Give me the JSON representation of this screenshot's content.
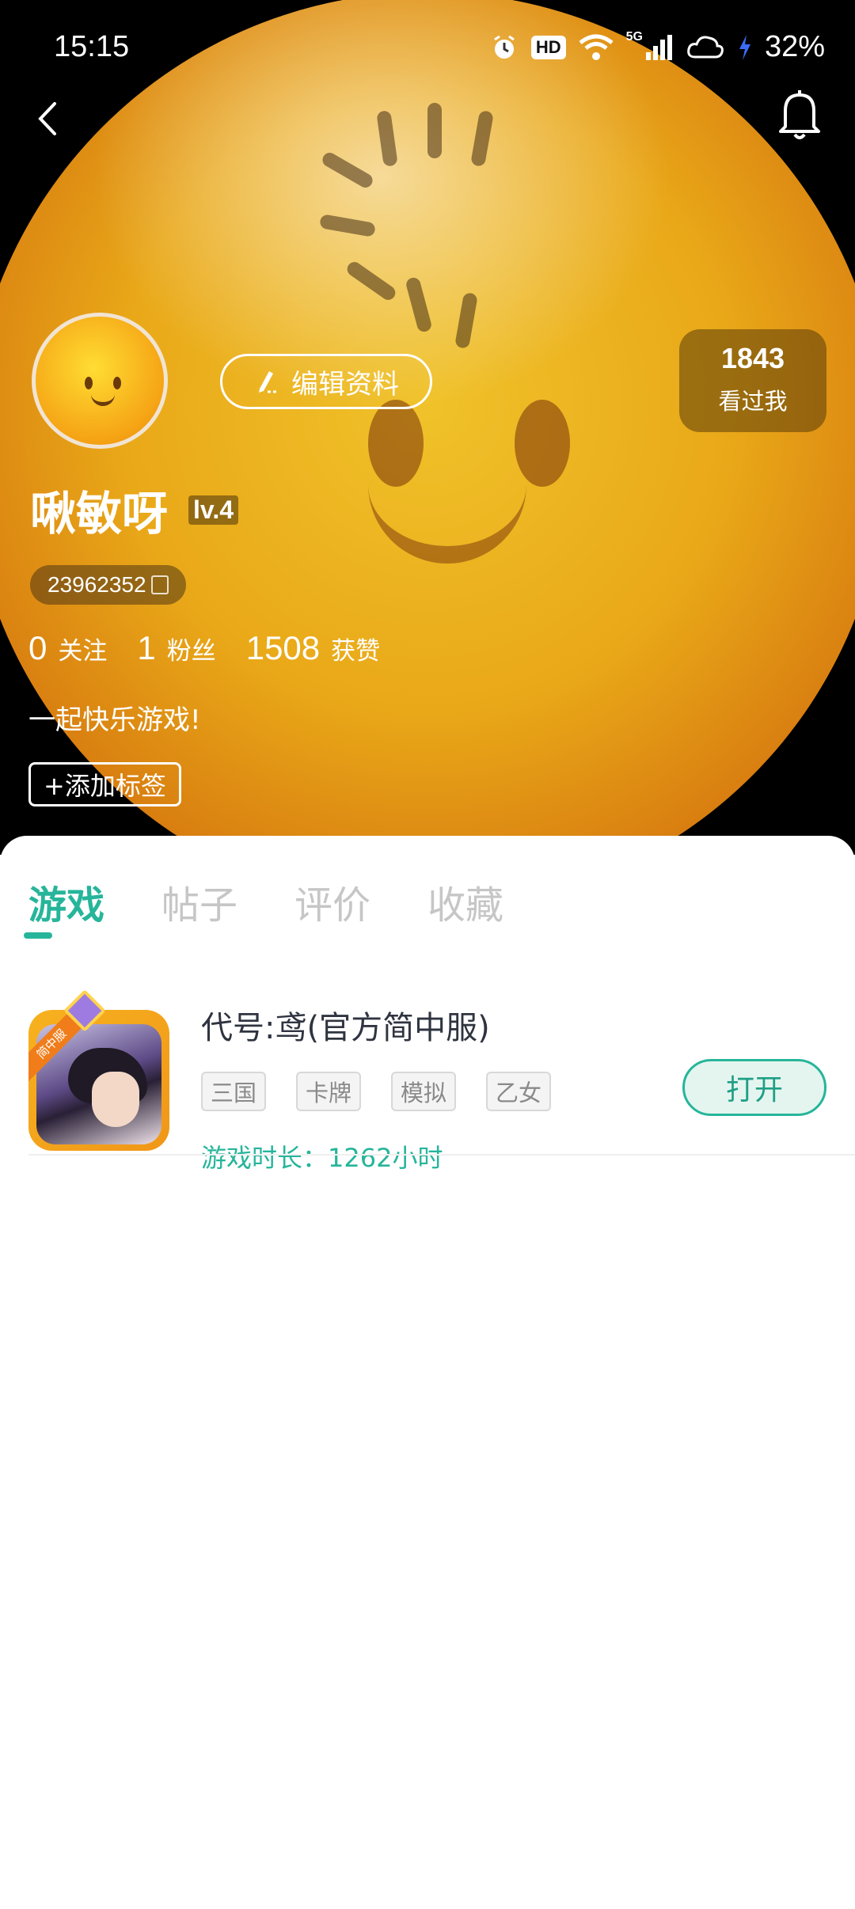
{
  "status_bar": {
    "time": "15:15",
    "hd_label": "HD",
    "network_label": "5G",
    "battery": "32%"
  },
  "profile": {
    "edit_label": "编辑资料",
    "visitors_count": "1843",
    "visitors_label": "看过我",
    "username": "啾敏呀",
    "level": "lv.4",
    "uid": "23962352",
    "stats": {
      "following_count": "0",
      "following_label": "关注",
      "fans_count": "1",
      "fans_label": "粉丝",
      "likes_count": "1508",
      "likes_label": "获赞"
    },
    "bio": "一起快乐游戏!",
    "add_tag_label": "+添加标签"
  },
  "tabs": [
    {
      "label": "游戏",
      "active": true
    },
    {
      "label": "帖子",
      "active": false
    },
    {
      "label": "评价",
      "active": false
    },
    {
      "label": "收藏",
      "active": false
    }
  ],
  "games": [
    {
      "title": "代号:鸢(官方简中服)",
      "icon_ribbon": "简中服",
      "tags": [
        "三国",
        "卡牌",
        "模拟",
        "乙女"
      ],
      "playtime": "游戏时长：1262小时",
      "action_label": "打开"
    }
  ],
  "colors": {
    "accent": "#26b59a",
    "hero_yellow": "#e9a818"
  },
  "icons": {
    "back": "chevron-left-icon",
    "notifications": "bell-icon",
    "edit": "pencil-icon",
    "copy": "copy-icon"
  }
}
